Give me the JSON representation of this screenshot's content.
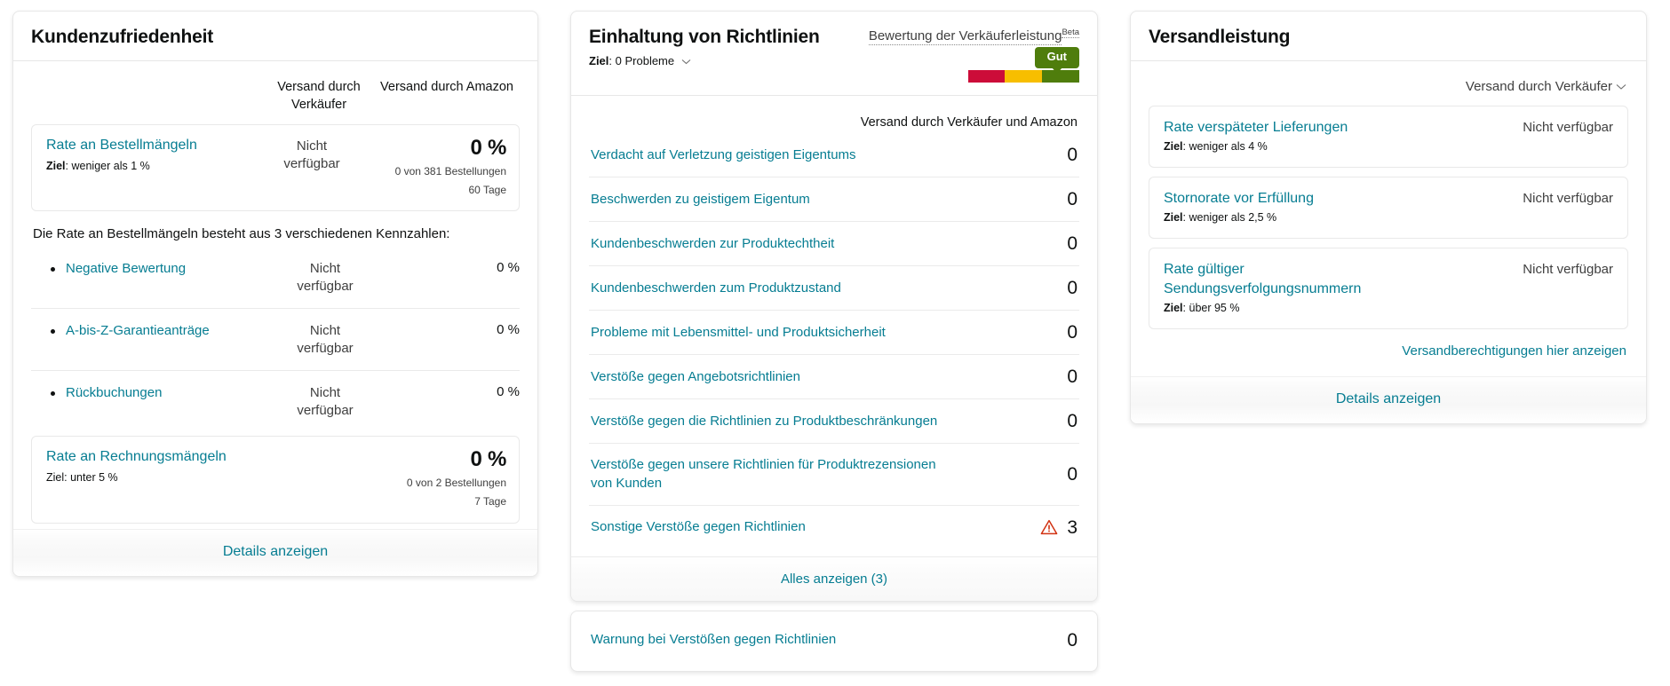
{
  "customer_satisfaction": {
    "title": "Kundenzufriedenheit",
    "column_headers": {
      "seller_fulfilled": "Versand durch\nVerkäufer",
      "amazon_fulfilled": "Versand durch Amazon"
    },
    "odr": {
      "name": "Rate an Bestellmängeln",
      "goal_label": "Ziel",
      "goal_value": "weniger als 1 %",
      "seller_value": "Nicht\nverfügbar",
      "amazon_value": "0 %",
      "amazon_sub1": "0 von 381 Bestellungen",
      "amazon_sub2": "60 Tage"
    },
    "breakdown_title": "Die Rate an Bestellmängeln besteht aus 3 verschiedenen Kennzahlen:",
    "breakdown": [
      {
        "name": "Negative Bewertung",
        "seller_value": "Nicht\nverfügbar",
        "amazon_value": "0 %"
      },
      {
        "name": "A-bis-Z-Garantieanträge",
        "seller_value": "Nicht\nverfügbar",
        "amazon_value": "0 %"
      },
      {
        "name": "Rückbuchungen",
        "seller_value": "Nicht\nverfügbar",
        "amazon_value": "0 %"
      }
    ],
    "invoice_defect": {
      "name": "Rate an Rechnungsmängeln",
      "goal_label": "Ziel",
      "goal_value": "unter 5 %",
      "value": "0 %",
      "sub1": "0 von 2 Bestellungen",
      "sub2": "7 Tage"
    },
    "footer_link": "Details anzeigen"
  },
  "policy_compliance": {
    "title": "Einhaltung von Richtlinien",
    "goal_label": "Ziel",
    "goal_value": "0 Probleme",
    "rating_link": "Bewertung der Verkäuferleistung",
    "rating_badge_sup": "Beta",
    "gauge": {
      "status_label": "Gut",
      "segments": [
        "red",
        "amber",
        "green"
      ],
      "active_segment": "green",
      "colors": {
        "red": "#CC0C39",
        "amber": "#F7BE00",
        "green": "#4F7D0C"
      }
    },
    "column_header": "Versand durch Verkäufer und Amazon",
    "items": [
      {
        "name": "Verdacht auf Verletzung geistigen Eigentums",
        "value": "0",
        "warning": false
      },
      {
        "name": "Beschwerden zu geistigem Eigentum",
        "value": "0",
        "warning": false
      },
      {
        "name": "Kundenbeschwerden zur Produktechtheit",
        "value": "0",
        "warning": false
      },
      {
        "name": "Kundenbeschwerden zum Produktzustand",
        "value": "0",
        "warning": false
      },
      {
        "name": "Probleme mit Lebensmittel- und Produktsicherheit",
        "value": "0",
        "warning": false
      },
      {
        "name": "Verstöße gegen Angebotsrichtlinien",
        "value": "0",
        "warning": false
      },
      {
        "name": "Verstöße gegen die Richtlinien zu Produktbeschränkungen",
        "value": "0",
        "warning": false
      },
      {
        "name": "Verstöße gegen unsere Richtlinien für Produktrezensionen von Kunden",
        "value": "0",
        "warning": false
      },
      {
        "name": "Sonstige Verstöße gegen Richtlinien",
        "value": "3",
        "warning": true
      }
    ],
    "show_all_link": "Alles anzeigen (3)",
    "warning_card": {
      "name": "Warnung bei Verstößen gegen Richtlinien",
      "value": "0"
    }
  },
  "shipping_performance": {
    "title": "Versandleistung",
    "channel_selector": "Versand durch Verkäufer",
    "metrics": [
      {
        "name": "Rate verspäteter Lieferungen",
        "goal_label": "Ziel",
        "goal_value": "weniger als 4 %",
        "value": "Nicht verfügbar"
      },
      {
        "name": "Stornorate vor Erfüllung",
        "goal_label": "Ziel",
        "goal_value": "weniger als 2,5 %",
        "value": "Nicht verfügbar"
      },
      {
        "name": "Rate gültiger Sendungsverfolgungsnummern",
        "goal_label": "Ziel",
        "goal_value": "über 95 %",
        "value": "Nicht verfügbar"
      }
    ],
    "permissions_link": "Versandberechtigungen hier anzeigen",
    "footer_link": "Details anzeigen"
  },
  "colors": {
    "link": "#067d92",
    "text": "#0f1111",
    "muted": "#3f3f3f",
    "border": "#e7e7e7",
    "warning": "#d13212",
    "gauge_red": "#CC0C39",
    "gauge_amber": "#F7BE00",
    "gauge_green": "#4F7D0C"
  }
}
